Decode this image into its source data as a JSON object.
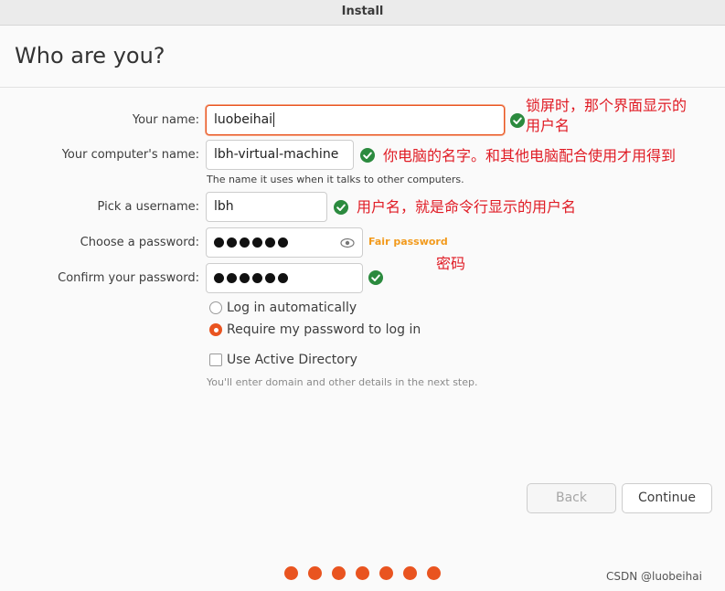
{
  "window": {
    "title": "Install"
  },
  "page": {
    "title": "Who are you?"
  },
  "form": {
    "name_label": "Your name:",
    "name_value": "luobeihai",
    "computer_label": "Your computer's name:",
    "computer_value": "lbh-virtual-machine",
    "computer_hint": "The name it uses when it talks to other computers.",
    "username_label": "Pick a username:",
    "username_value": "lbh",
    "password_label": "Choose a password:",
    "password_strength": "Fair password",
    "confirm_label": "Confirm your password:",
    "login_auto_label": "Log in automatically",
    "login_require_label": "Require my password to log in",
    "login_mode_selected": "require",
    "active_directory_label": "Use Active Directory",
    "active_directory_checked": false,
    "active_directory_hint": "You'll enter domain and other details in the next step."
  },
  "annotations": {
    "name_note_line1": "锁屏时，那个界面显示的",
    "name_note_line2": "用户名",
    "computer_note": "你电脑的名字。和其他电脑配合使用才用得到",
    "username_note": "用户名，就是命令行显示的用户名",
    "password_note": "密码"
  },
  "buttons": {
    "back": "Back",
    "continue": "Continue"
  },
  "progress": {
    "total_steps": 7
  },
  "watermark": "CSDN @luobeihai",
  "colors": {
    "accent": "#e95420",
    "valid": "#2b8a3e",
    "annotation": "#e01b24",
    "strength": "#f29a1c"
  }
}
